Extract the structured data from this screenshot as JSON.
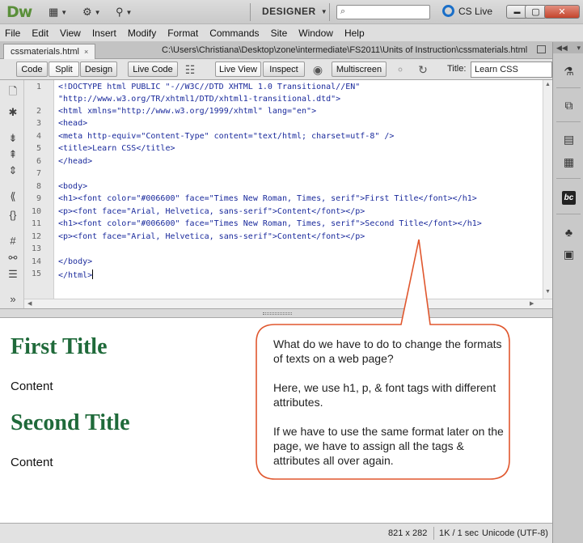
{
  "app": {
    "logo": "Dw",
    "workspace": "DESIGNER",
    "search_placeholder": "",
    "cslive": "CS Live",
    "window_minimize": "▬",
    "window_maximize": "▢",
    "window_close": "✕"
  },
  "menu": [
    "File",
    "Edit",
    "View",
    "Insert",
    "Modify",
    "Format",
    "Commands",
    "Site",
    "Window",
    "Help"
  ],
  "document": {
    "tab": "cssmaterials.html",
    "tab_close": "×",
    "path": "C:\\Users\\Christiana\\Desktop\\zone\\intermediate\\FS2011\\Units of Instruction\\cssmaterials.html"
  },
  "toolbar": {
    "code": "Code",
    "split": "Split",
    "design": "Design",
    "live_code": "Live Code",
    "live_view": "Live View",
    "inspect": "Inspect",
    "multiscreen": "Multiscreen",
    "title_label": "Title:",
    "title_value": "Learn CSS"
  },
  "code_lines": [
    {
      "n": "1",
      "text": "<!DOCTYPE html PUBLIC \"-//W3C//DTD XHTML 1.0 Transitional//EN\""
    },
    {
      "n": "",
      "text": "\"http://www.w3.org/TR/xhtml1/DTD/xhtml1-transitional.dtd\">"
    },
    {
      "n": "2",
      "text": "<html xmlns=\"http://www.w3.org/1999/xhtml\" lang=\"en\">"
    },
    {
      "n": "3",
      "text": "<head>"
    },
    {
      "n": "4",
      "text": "<meta http-equiv=\"Content-Type\" content=\"text/html; charset=utf-8\" />"
    },
    {
      "n": "5",
      "text": "<title>Learn CSS</title>"
    },
    {
      "n": "6",
      "text": "</head>"
    },
    {
      "n": "7",
      "text": ""
    },
    {
      "n": "8",
      "text": "<body>"
    },
    {
      "n": "9",
      "text": "<h1><font color=\"#006600\" face=\"Times New Roman, Times, serif\">First Title</font></h1>"
    },
    {
      "n": "10",
      "text": "<p><font face=\"Arial, Helvetica, sans-serif\">Content</font></p>"
    },
    {
      "n": "11",
      "text": "<h1><font color=\"#006600\" face=\"Times New Roman, Times, serif\">Second Title</font></h1>"
    },
    {
      "n": "12",
      "text": "<p><font face=\"Arial, Helvetica, sans-serif\">Content</font></p>"
    },
    {
      "n": "13",
      "text": ""
    },
    {
      "n": "14",
      "text": "</body>"
    },
    {
      "n": "15",
      "text": "</html>"
    }
  ],
  "design_view": {
    "title1": "First Title",
    "content1": "Content",
    "title2": "Second Title",
    "content2": "Content"
  },
  "callout": {
    "p1": "What do we have to do to change the formats of texts on a web page?",
    "p2": "Here, we use h1, p, & font tags with different attributes.",
    "p3": "If we have to use the same format later on the page, we have to assign all the tags & attributes all over again."
  },
  "status": {
    "size": "821 x 282",
    "download": "1K / 1 sec",
    "encoding": "Unicode (UTF-8)"
  },
  "colors": {
    "heading_green": "#1f6a3a",
    "callout_border": "#e0572e"
  }
}
